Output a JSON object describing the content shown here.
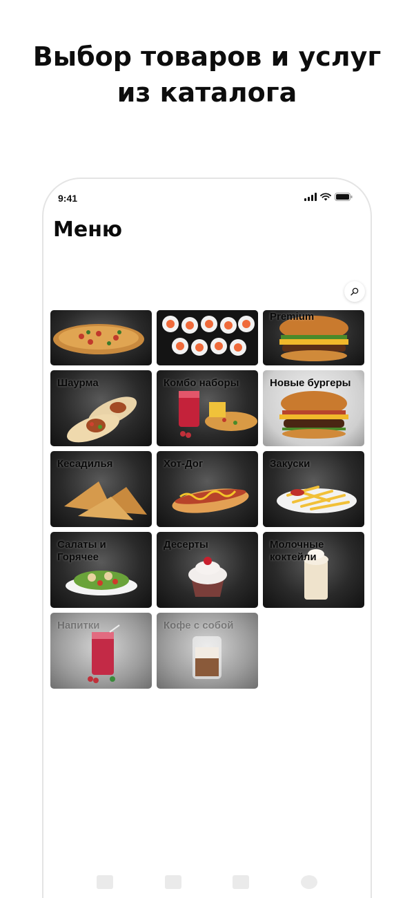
{
  "headline": {
    "line1": "Выбор товаров и услуг",
    "line2": "из каталога"
  },
  "status_bar": {
    "time": "9:41",
    "icons": [
      "signal-icon",
      "wifi-icon",
      "battery-icon"
    ]
  },
  "menu": {
    "title": "Меню",
    "search_icon": "search-icon"
  },
  "categories": [
    {
      "label": "",
      "image": "pizza"
    },
    {
      "label": "",
      "image": "sushi-rolls"
    },
    {
      "label": "Premium",
      "image": "burger"
    },
    {
      "label": "Шаурма",
      "image": "shawarma"
    },
    {
      "label": "Комбо наборы",
      "image": "combo"
    },
    {
      "label": "Новые бургеры",
      "image": "burger"
    },
    {
      "label": "Кесадилья",
      "image": "quesadilla"
    },
    {
      "label": "Хот-Дог",
      "image": "hot-dog"
    },
    {
      "label": "Закуски",
      "image": "fries"
    },
    {
      "label": "Салаты и Горячее",
      "image": "salad"
    },
    {
      "label": "Десерты",
      "image": "cupcake"
    },
    {
      "label": "Молочные коктейли",
      "image": "milkshake"
    },
    {
      "label": "Напитки",
      "image": "drink"
    },
    {
      "label": "Кофе с собой",
      "image": "coffee"
    }
  ],
  "colors": {
    "background": "#ffffff",
    "text": "#0d0d0d",
    "tile_dark": "#2a2a2a",
    "tile_light": "#e6e6e6"
  }
}
